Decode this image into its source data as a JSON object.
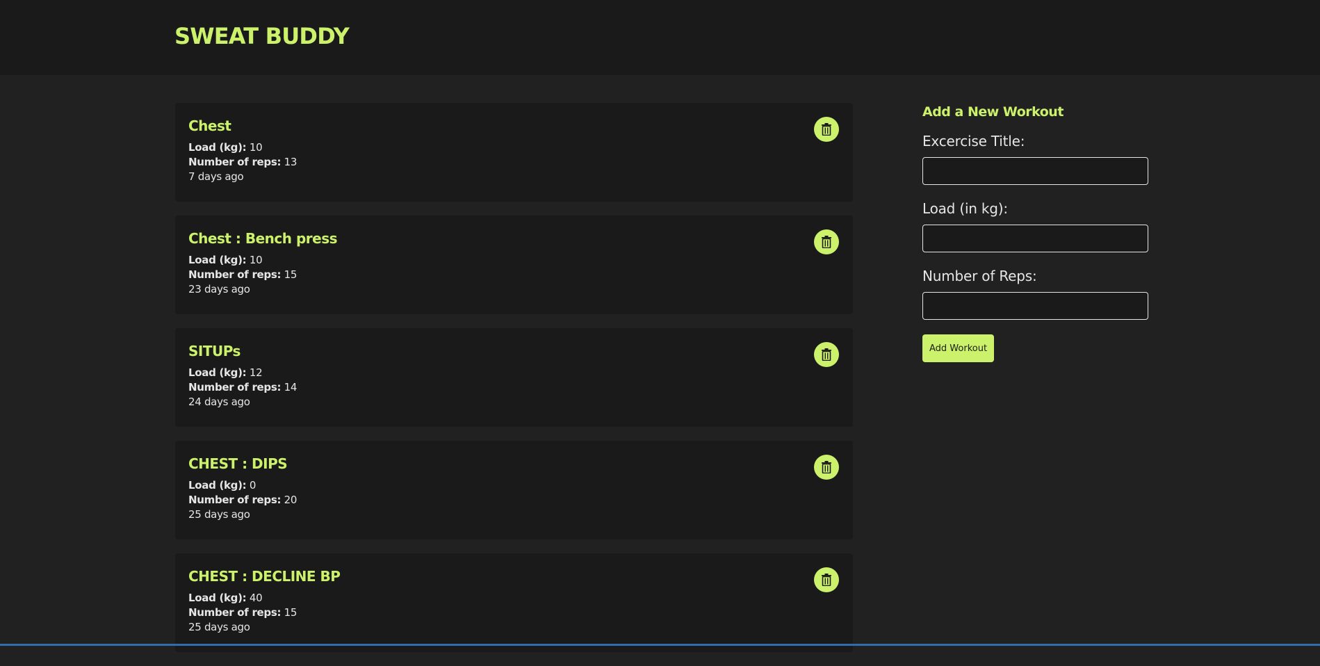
{
  "app": {
    "title": "SWEAT BUDDY"
  },
  "colors": {
    "accent": "#ccf26b",
    "background": "#212121",
    "card": "#1a1a1a",
    "text": "#e6e6e6"
  },
  "labels": {
    "load": "Load (kg):",
    "reps": "Number of reps:"
  },
  "workouts": [
    {
      "title": "Chest",
      "load": "10",
      "reps": "13",
      "time_ago": "7 days ago",
      "delete_icon": "trash-icon"
    },
    {
      "title": "Chest : Bench press",
      "load": "10",
      "reps": "15",
      "time_ago": "23 days ago",
      "delete_icon": "trash-icon"
    },
    {
      "title": "SITUPs",
      "load": "12",
      "reps": "14",
      "time_ago": "24 days ago",
      "delete_icon": "trash-icon"
    },
    {
      "title": "CHEST : DIPS",
      "load": "0",
      "reps": "20",
      "time_ago": "25 days ago",
      "delete_icon": "trash-icon"
    },
    {
      "title": "CHEST : DECLINE BP",
      "load": "40",
      "reps": "15",
      "time_ago": "25 days ago",
      "delete_icon": "trash-icon"
    }
  ],
  "form": {
    "title": "Add a New Workout",
    "title_label": "Excercise Title:",
    "title_value": "",
    "load_label": "Load (in kg):",
    "load_value": "",
    "reps_label": "Number of Reps:",
    "reps_value": "",
    "submit_label": "Add Workout"
  }
}
